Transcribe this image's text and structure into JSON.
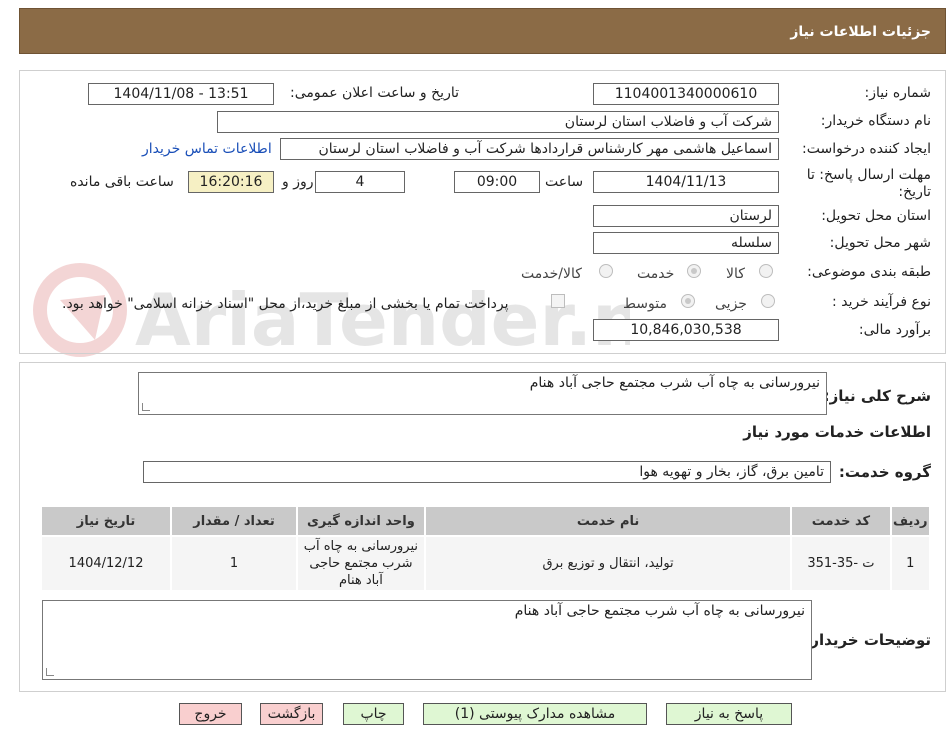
{
  "header": {
    "title": "جزئیات اطلاعات نیاز"
  },
  "watermark": {
    "text": "AriaTender.neT"
  },
  "form": {
    "need_number_label": "شماره نیاز:",
    "need_number": "1104001340000610",
    "announce_label": "تاریخ و ساعت اعلان عمومی:",
    "announce_value": "1404/11/08 - 13:51",
    "buyer_org_label": "نام دستگاه خریدار:",
    "buyer_org": "شرکت آب و فاضلاب استان لرستان",
    "requester_label": "ایجاد کننده درخواست:",
    "requester": "اسماعیل هاشمی مهر کارشناس قراردادها شرکت آب و فاضلاب استان لرستان",
    "contact_link": "اطلاعات تماس خریدار",
    "deadline_label_1": "مهلت ارسال پاسخ: تا",
    "deadline_label_2": "تاریخ:",
    "deadline_date": "1404/11/13",
    "hour_label": "ساعت",
    "deadline_time": "09:00",
    "days_value": "4",
    "days_label": "روز و",
    "remaining_time": "16:20:16",
    "remaining_label": "ساعت باقی مانده",
    "province_label": "استان محل تحویل:",
    "province": "لرستان",
    "city_label": "شهر محل تحویل:",
    "city": "سلسله",
    "category_label": "طبقه بندی موضوعی:",
    "category_options": [
      "کالا",
      "خدمت",
      "کالا/خدمت"
    ],
    "process_label": "نوع فرآیند خرید :",
    "process_options": [
      "جزیی",
      "متوسط"
    ],
    "payment_note": "پرداخت تمام یا بخشی از مبلغ خرید،از محل \"اسناد خزانه اسلامی\" خواهد بود.",
    "budget_label": "برآورد مالی:",
    "budget": "10,846,030,538"
  },
  "details": {
    "summary_label": "شرح کلی نیاز:",
    "summary": "نیرورسانی به چاه آب شرب مجتمع حاجی آباد هنام",
    "services_title": "اطلاعات خدمات مورد نیاز",
    "service_group_label": "گروه خدمت:",
    "service_group": "تامین برق، گاز، بخار و تهویه هوا",
    "table": {
      "headers": [
        "ردیف",
        "کد خدمت",
        "نام خدمت",
        "واحد اندازه گیری",
        "تعداد / مقدار",
        "تاریخ نیاز"
      ],
      "rows": [
        [
          "1",
          "ت -35-351",
          "تولید، انتقال و توزیع برق",
          "نیرورسانی به چاه آب شرب مجتمع حاجی آباد هنام",
          "1",
          "1404/12/12"
        ]
      ]
    },
    "buyer_notes_label": "توضیحات خریدار:",
    "buyer_notes": "نیرورسانی به چاه آب شرب مجتمع حاجی آباد هنام"
  },
  "buttons": {
    "reply": "پاسخ به نیاز",
    "attachments": "مشاهده مدارک پیوستی (1)",
    "print": "چاپ",
    "back": "بازگشت",
    "exit": "خروج"
  }
}
